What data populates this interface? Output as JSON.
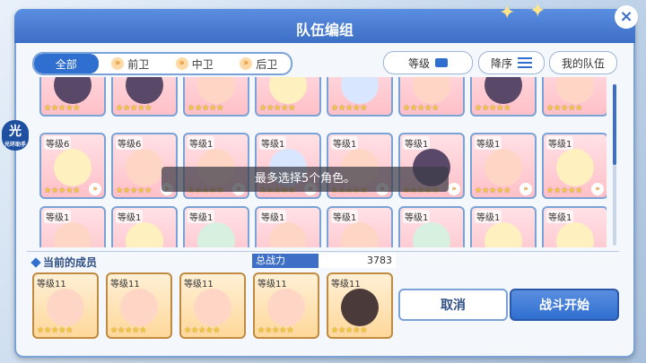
{
  "window": {
    "title": "队伍编组",
    "close_label": "×"
  },
  "filter_tabs": [
    {
      "label": "全部",
      "active": true
    },
    {
      "label": "前卫",
      "active": false
    },
    {
      "label": "中卫",
      "active": false
    },
    {
      "label": "后卫",
      "active": false
    }
  ],
  "controls": {
    "sort_label": "等级",
    "order_label": "降序",
    "my_team_label": "我的队伍"
  },
  "roster_row_top": {
    "stars": "★★★★★"
  },
  "roster_row_2": [
    {
      "level": "等级6",
      "stars": "★★★★★"
    },
    {
      "level": "等级6",
      "stars": "★★★★★"
    },
    {
      "level": "等级1",
      "stars": "★★★★★"
    },
    {
      "level": "等级1",
      "stars": "★★★★★"
    },
    {
      "level": "等级1",
      "stars": "★★★★★"
    },
    {
      "level": "等级1",
      "stars": "★★★★★"
    },
    {
      "level": "等级1",
      "stars": "★★★★★"
    },
    {
      "level": "等级1",
      "stars": "★★★★★"
    }
  ],
  "roster_row_3": [
    {
      "level": "等级1"
    },
    {
      "level": "等级1"
    },
    {
      "level": "等级1"
    },
    {
      "level": "等级1"
    },
    {
      "level": "等级1"
    },
    {
      "level": "等级1"
    },
    {
      "level": "等级1"
    },
    {
      "level": "等级1"
    }
  ],
  "toast": "最多选择5个角色。",
  "current_members": {
    "label": "当前的成员",
    "power_label": "总战力",
    "power_value": "3783"
  },
  "members": [
    {
      "level": "等级11",
      "stars": "★★★★★"
    },
    {
      "level": "等级11",
      "stars": "★★★★★"
    },
    {
      "level": "等级11",
      "stars": "★★★★★"
    },
    {
      "level": "等级11",
      "stars": "★★★★★"
    },
    {
      "level": "等级11",
      "stars": "★★★★★"
    }
  ],
  "actions": {
    "cancel": "取消",
    "start": "战斗开始"
  },
  "side_badge": {
    "glyph": "光",
    "text": "光环助手"
  },
  "colors": {
    "accent": "#2f6fd0",
    "title_bg": "#3d6fc6"
  }
}
